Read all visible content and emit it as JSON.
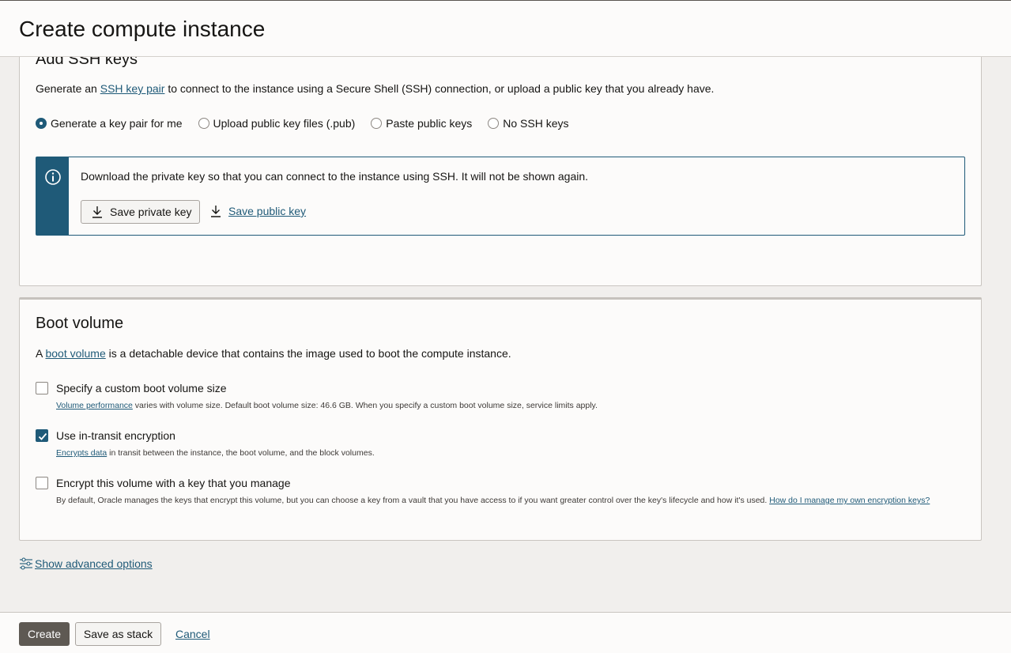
{
  "page_title": "Create compute instance",
  "ssh": {
    "heading": "Add SSH keys",
    "desc_prefix": "Generate an ",
    "desc_link": "SSH key pair",
    "desc_suffix": " to connect to the instance using a Secure Shell (SSH) connection, or upload a public key that you already have.",
    "options": [
      {
        "label": "Generate a key pair for me",
        "selected": true
      },
      {
        "label": "Upload public key files (.pub)",
        "selected": false
      },
      {
        "label": "Paste public keys",
        "selected": false
      },
      {
        "label": "No SSH keys",
        "selected": false
      }
    ],
    "info_message": "Download the private key so that you can connect to the instance using SSH. It will not be shown again.",
    "save_private_label": "Save private key",
    "save_public_label": "Save public key"
  },
  "boot": {
    "heading": "Boot volume",
    "desc_prefix": "A ",
    "desc_link": "boot volume",
    "desc_suffix": " is a detachable device that contains the image used to boot the compute instance.",
    "custom_size": {
      "label": "Specify a custom boot volume size",
      "checked": false,
      "help_link": "Volume performance",
      "help_text": " varies with volume size. Default boot volume size: 46.6 GB. When you specify a custom boot volume size, service limits apply."
    },
    "in_transit": {
      "label": "Use in-transit encryption",
      "checked": true,
      "help_link": "Encrypts data",
      "help_text": " in transit between the instance, the boot volume, and the block volumes."
    },
    "own_key": {
      "label": "Encrypt this volume with a key that you manage",
      "checked": false,
      "help_text": "By default, Oracle manages the keys that encrypt this volume, but you can choose a key from a vault that you have access to if you want greater control over the key's lifecycle and how it's used. ",
      "help_link": "How do I manage my own encryption keys?"
    }
  },
  "advanced_label": "Show advanced options",
  "footer": {
    "create_label": "Create",
    "stack_label": "Save as stack",
    "cancel_label": "Cancel"
  },
  "colors": {
    "accent": "#1f5a78",
    "primary_button": "#5e5953"
  }
}
